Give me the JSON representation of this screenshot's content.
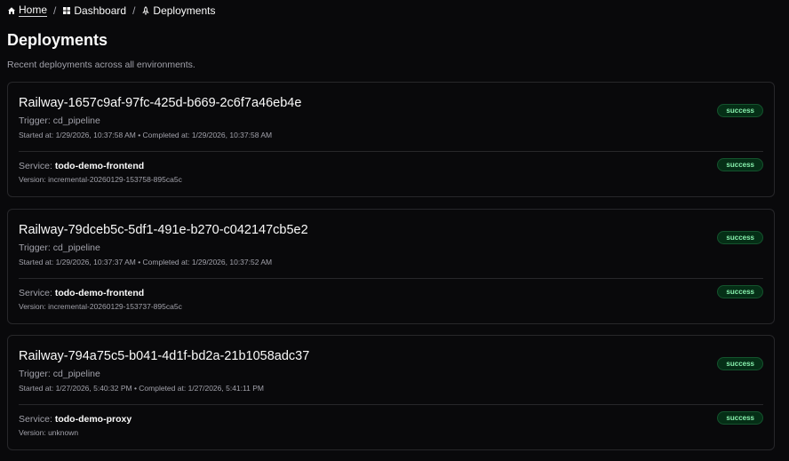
{
  "breadcrumb": {
    "home": "Home",
    "dashboard": "Dashboard",
    "deployments": "Deployments",
    "separator": "/"
  },
  "page": {
    "title": "Deployments",
    "subtitle": "Recent deployments across all environments."
  },
  "labels": {
    "service": "Service:"
  },
  "colors": {
    "background": "#09090b",
    "card_border": "#27272a",
    "muted_text": "#a1a1aa",
    "success_bg": "#052e16",
    "success_text": "#86efac"
  },
  "deployments": [
    {
      "name": "Railway-1657c9af-97fc-425d-b669-2c6f7a46eb4e",
      "trigger": "Trigger: cd_pipeline",
      "times": "Started at: 1/29/2026, 10:37:58 AM • Completed at: 1/29/2026, 10:37:58 AM",
      "status": "success",
      "service": "todo-demo-frontend",
      "version": "Version: incremental-20260129-153758-895ca5c",
      "service_status": "success"
    },
    {
      "name": "Railway-79dceb5c-5df1-491e-b270-c042147cb5e2",
      "trigger": "Trigger: cd_pipeline",
      "times": "Started at: 1/29/2026, 10:37:37 AM • Completed at: 1/29/2026, 10:37:52 AM",
      "status": "success",
      "service": "todo-demo-frontend",
      "version": "Version: incremental-20260129-153737-895ca5c",
      "service_status": "success"
    },
    {
      "name": "Railway-794a75c5-b041-4d1f-bd2a-21b1058adc37",
      "trigger": "Trigger: cd_pipeline",
      "times": "Started at: 1/27/2026, 5:40:32 PM • Completed at: 1/27/2026, 5:41:11 PM",
      "status": "success",
      "service": "todo-demo-proxy",
      "version": "Version: unknown",
      "service_status": "success"
    }
  ]
}
